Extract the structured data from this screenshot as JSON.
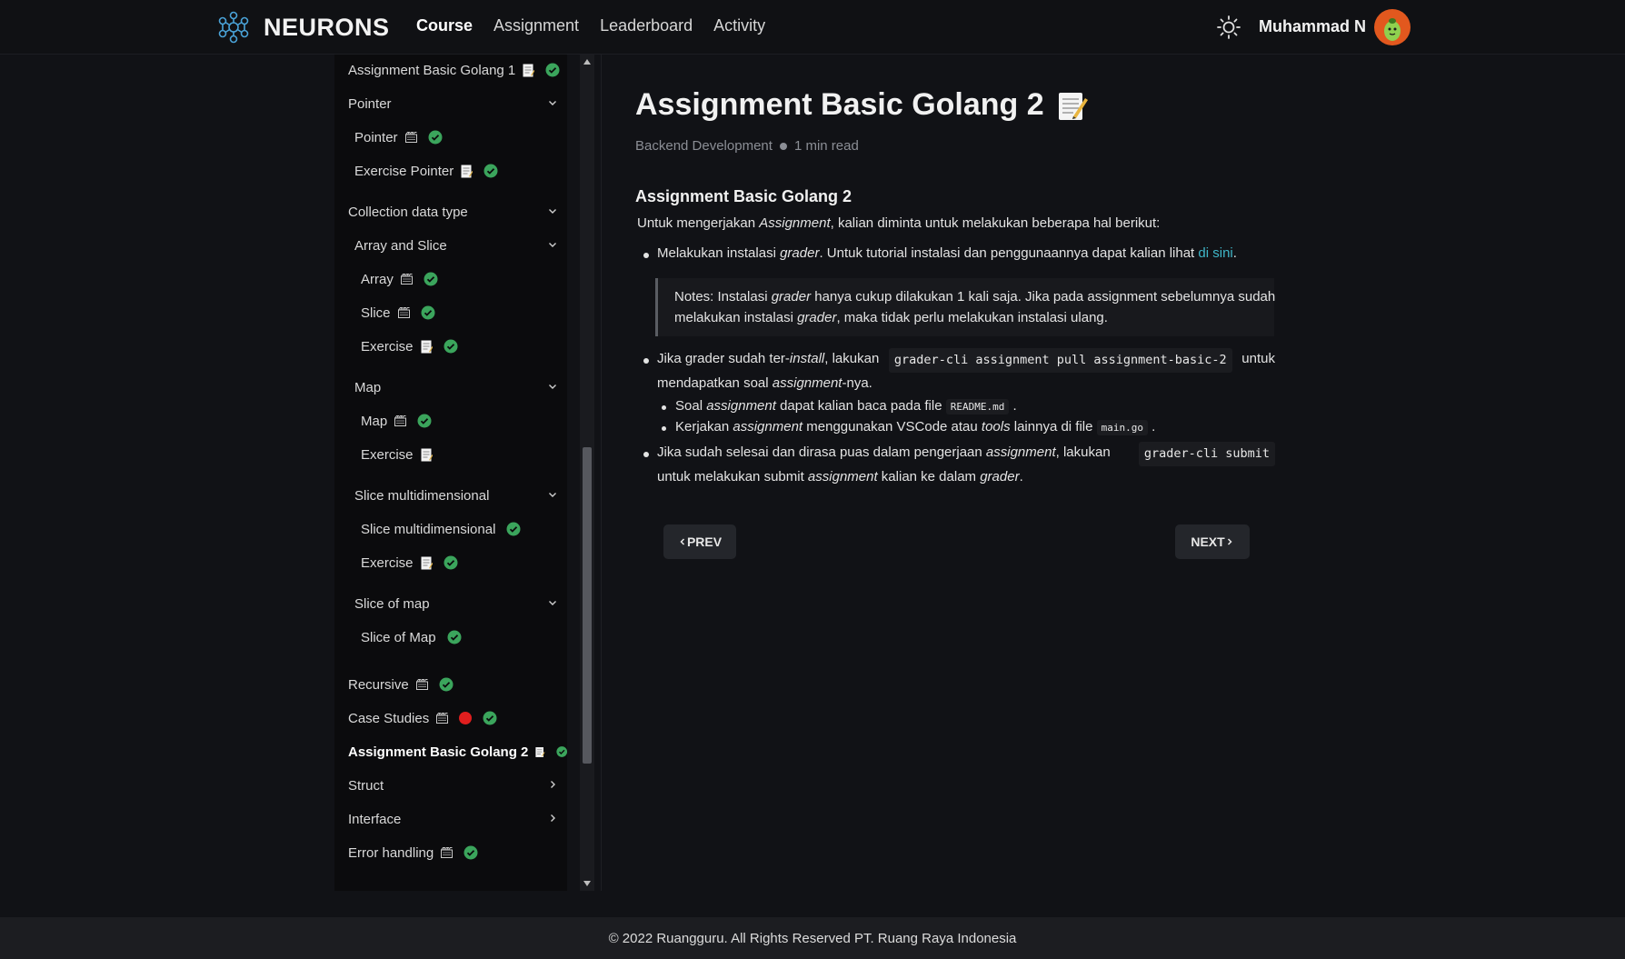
{
  "header": {
    "brand": "NEURONS",
    "nav": [
      "Course",
      "Assignment",
      "Leaderboard",
      "Activity"
    ],
    "active_nav": "Course",
    "user_name": "Muhammad N"
  },
  "sidebar": {
    "items": [
      {
        "label": "Assignment Basic Golang 1",
        "icon": "doc-icon",
        "done": true
      },
      {
        "label": "Pointer",
        "expandable": true
      },
      {
        "label": "Pointer",
        "icon": "video-icon",
        "done": true
      },
      {
        "label": "Exercise Pointer",
        "icon": "doc-icon",
        "done": true
      },
      {
        "label": "Collection data type",
        "expandable": true
      },
      {
        "label": "Array and Slice",
        "expandable": true
      },
      {
        "label": "Array",
        "icon": "video-icon",
        "done": true
      },
      {
        "label": "Slice",
        "icon": "video-icon",
        "done": true
      },
      {
        "label": "Exercise",
        "icon": "doc-icon",
        "done": true
      },
      {
        "label": "Map",
        "expandable": true
      },
      {
        "label": "Map",
        "icon": "video-icon",
        "done": true
      },
      {
        "label": "Exercise",
        "icon": "doc-icon",
        "done": false
      },
      {
        "label": "Slice multidimensional",
        "expandable": true
      },
      {
        "label": "Slice multidimensional",
        "done": true
      },
      {
        "label": "Exercise",
        "icon": "doc-icon",
        "done": true
      },
      {
        "label": "Slice of map",
        "expandable": true
      },
      {
        "label": "Slice of Map",
        "done": true
      },
      {
        "label": "Recursive",
        "icon": "video-icon",
        "done": true
      },
      {
        "label": "Case Studies",
        "icon": "video-icon",
        "live": true,
        "done": true
      },
      {
        "label": "Assignment Basic Golang 2",
        "icon": "doc-icon",
        "done": true,
        "active": true
      },
      {
        "label": "Struct",
        "collapsed": true
      },
      {
        "label": "Interface",
        "collapsed": true
      },
      {
        "label": "Error handling",
        "icon": "video-icon",
        "done": true
      }
    ]
  },
  "article": {
    "title": "Assignment Basic Golang 2",
    "category": "Backend Development",
    "read_time": "1 min read",
    "heading": "Assignment Basic Golang 2",
    "intro_a": "Untuk mengerjakan ",
    "intro_em": "Assignment",
    "intro_b": ", kalian diminta untuk melakukan beberapa hal berikut:",
    "b1_a": "Melakukan instalasi ",
    "b1_em": "grader",
    "b1_b": ". Untuk tutorial instalasi dan penggunaannya dapat kalian lihat ",
    "b1_link": "di sini",
    "b1_c": ".",
    "note_a": "Notes: Instalasi ",
    "note_em1": "grader",
    "note_b": " hanya cukup dilakukan 1 kali saja. Jika pada assignment sebelumnya sudah",
    "note_c": "melakukan instalasi ",
    "note_em2": "grader",
    "note_d": ", maka tidak perlu melakukan instalasi ulang.",
    "b2_a": "Jika grader sudah ter-",
    "b2_em": "install",
    "b2_b": ", lakukan",
    "b2_code": "grader-cli assignment pull assignment-basic-2",
    "b2_c": "untuk",
    "b2_d": "mendapatkan soal ",
    "b2_em2": "assignment",
    "b2_e": "-nya.",
    "s1_a": "Soal ",
    "s1_em": "assignment",
    "s1_b": " dapat kalian baca pada file ",
    "s1_code": "README.md",
    "s1_c": " .",
    "s2_a": "Kerjakan ",
    "s2_em": "assignment",
    "s2_b": " menggunakan VSCode atau ",
    "s2_em2": "tools",
    "s2_c": " lainnya di file ",
    "s2_code": "main.go",
    "s2_d": " .",
    "b3_a": "Jika sudah selesai dan dirasa puas dalam pengerjaan ",
    "b3_em": "assignment",
    "b3_b": ", lakukan",
    "b3_code": "grader-cli submit",
    "b3_c": "untuk melakukan submit ",
    "b3_em2": "assignment",
    "b3_d": " kalian ke dalam ",
    "b3_em3": "grader",
    "b3_e": "."
  },
  "pager": {
    "prev": "PREV",
    "next": "NEXT"
  },
  "footer": "© 2022 Ruangguru. All Rights Reserved PT. Ruang Raya Indonesia",
  "colors": {
    "accent_link": "#3fb7c9",
    "check": "#3ba55c",
    "live": "#e01e1e"
  }
}
